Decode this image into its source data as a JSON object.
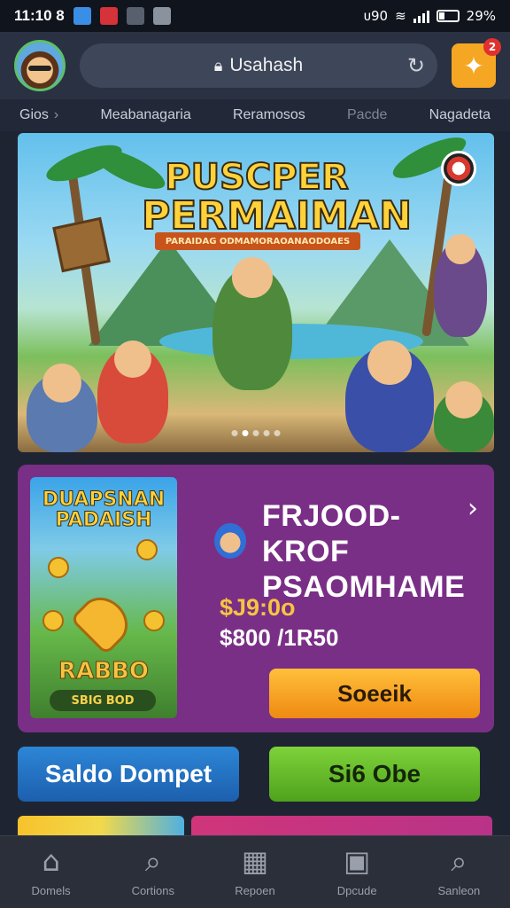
{
  "status_bar": {
    "time": "11:10 8",
    "right_text": "ᴜ90",
    "battery": "29%"
  },
  "top_bar": {
    "search_text": "Usahash",
    "gift_badge": "2",
    "icons": [
      "avatar",
      "lock-icon",
      "refresh-icon",
      "gift-icon"
    ]
  },
  "nav_tabs": [
    {
      "label": "Gios"
    },
    {
      "label": "Meabanagaria"
    },
    {
      "label": "Reramosos"
    },
    {
      "label": "Pacde"
    },
    {
      "label": "Nagadeta"
    }
  ],
  "hero": {
    "title_line1": "PUSCPER",
    "title_line2": "PERMAIMAN",
    "ribbon": "PARAIDAG ODMAMORAOANAODOAES",
    "carousel_total": 5,
    "carousel_active": 1
  },
  "promo": {
    "image_title": "DUAPSNAN PADAISH",
    "image_sub": "RABBO",
    "image_foot": "SBIG BOD",
    "title_line1": "FRJOOD-KROF",
    "title_line2": "PSAOMHAME",
    "price_old": "$J9:0o",
    "price_new": "$800 /1R50",
    "button_label": "Soeeik"
  },
  "actions": {
    "wallet_label": "Saldo Dompet",
    "obe_label": "Si6 Obe"
  },
  "bottom_nav": [
    {
      "label": "Domels",
      "icon": "home-icon",
      "glyph": "⌂"
    },
    {
      "label": "Cortions",
      "icon": "search-icon",
      "glyph": "⌕"
    },
    {
      "label": "Repoen",
      "icon": "calculator-icon",
      "glyph": "▦"
    },
    {
      "label": "Dpcude",
      "icon": "wallet-icon",
      "glyph": "▣"
    },
    {
      "label": "Sanleon",
      "icon": "search-icon",
      "glyph": "⌕"
    }
  ],
  "colors": {
    "background": "#1f2433",
    "promo_card": "#7a2f86",
    "accent_orange": "#f5a623",
    "wallet_blue": "#2d86d6",
    "obe_green": "#7ed23a"
  }
}
